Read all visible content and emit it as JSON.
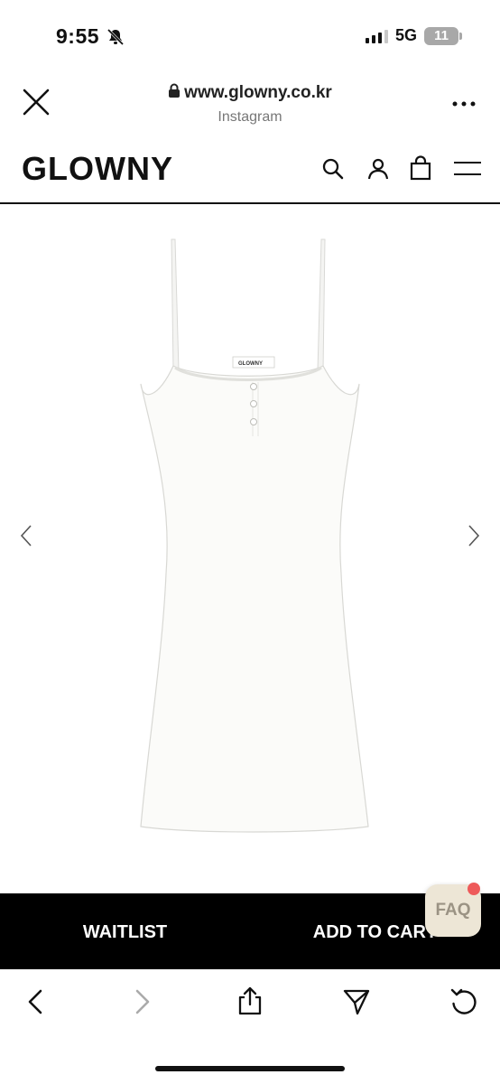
{
  "status": {
    "time": "9:55",
    "network": "5G",
    "battery": "11"
  },
  "browser": {
    "url": "www.glowny.co.kr",
    "source": "Instagram"
  },
  "site": {
    "logo": "GLOWNY"
  },
  "product": {
    "label_text": "GLOWNY"
  },
  "actions": {
    "waitlist": "WAITLIST",
    "add_to_cart": "ADD TO CART",
    "faq": "FAQ"
  }
}
